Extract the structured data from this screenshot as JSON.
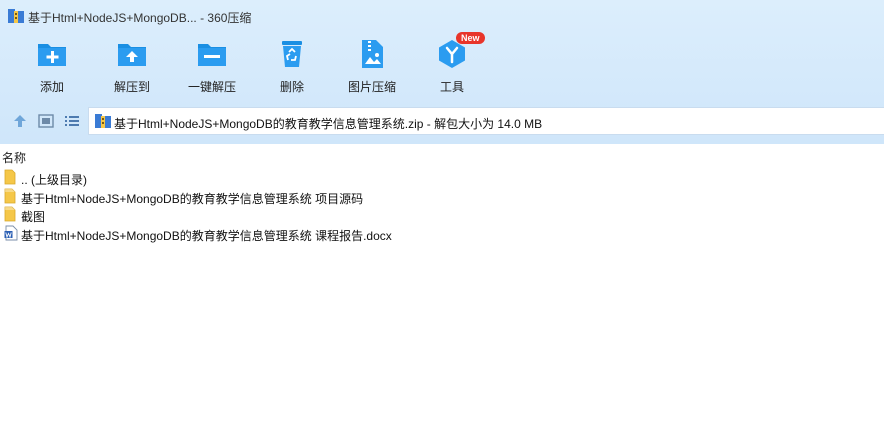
{
  "window": {
    "title": "基于Html+NodeJS+MongoDB... - 360压缩"
  },
  "toolbar": {
    "items": [
      {
        "label": "添加",
        "icon": "add-file-icon"
      },
      {
        "label": "解压到",
        "icon": "extract-to-icon"
      },
      {
        "label": "一键解压",
        "icon": "one-click-extract-icon"
      },
      {
        "label": "删除",
        "icon": "recycle-bin-icon"
      },
      {
        "label": "图片压缩",
        "icon": "image-compress-icon"
      },
      {
        "label": "工具",
        "icon": "tools-icon",
        "badge": "New"
      }
    ]
  },
  "address": {
    "path": "基于Html+NodeJS+MongoDB的教育教学信息管理系统.zip - 解包大小为 14.0 MB"
  },
  "list": {
    "column_name": "名称",
    "rows": [
      {
        "name": ".. (上级目录)",
        "type": "folder"
      },
      {
        "name": "基于Html+NodeJS+MongoDB的教育教学信息管理系统 项目源码",
        "type": "folder"
      },
      {
        "name": "截图",
        "type": "folder"
      },
      {
        "name": "基于Html+NodeJS+MongoDB的教育教学信息管理系统 课程报告.docx",
        "type": "word-document"
      }
    ]
  },
  "colors": {
    "accent": "#1a8fe3",
    "toolbar_bg": "#d4e9fb",
    "badge": "#e8352b",
    "folder": "#f5c748"
  }
}
